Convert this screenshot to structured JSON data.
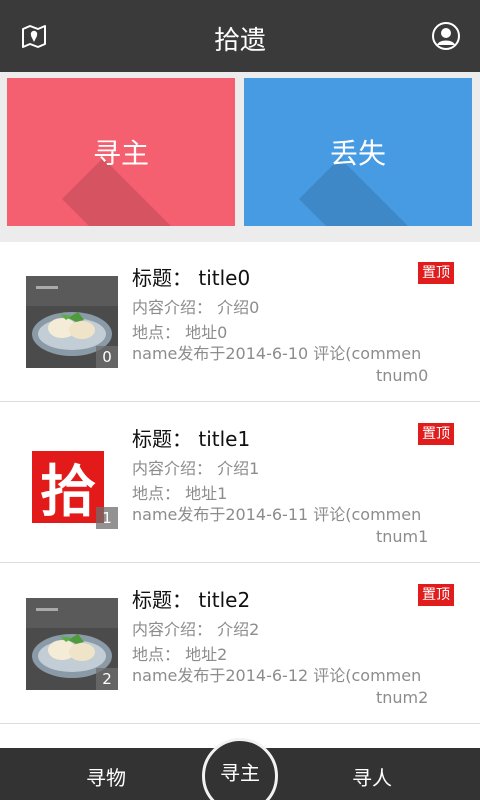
{
  "header": {
    "title": "拾遗",
    "left_icon": "map-pin-icon",
    "right_icon": "user-profile-icon"
  },
  "tiles": [
    {
      "label": "寻主",
      "color": "#f4606f"
    },
    {
      "label": "丢失",
      "color": "#479be3"
    }
  ],
  "list": {
    "items": [
      {
        "title": "标题： title0",
        "intro": "内容介绍： 介绍0",
        "location": "地点： 地址0",
        "meta_line1": "name发布于2014-6-10 评论(commen",
        "meta_line2": "tnum0",
        "pin": "置顶",
        "count": "0",
        "thumb": "dessert-photo"
      },
      {
        "title": "标题： title1",
        "intro": "内容介绍： 介绍1",
        "location": "地点： 地址1",
        "meta_line1": "name发布于2014-6-11 评论(commen",
        "meta_line2": "tnum1",
        "pin": "置顶",
        "count": "1",
        "thumb": "logo",
        "logo_char": "拾"
      },
      {
        "title": "标题： title2",
        "intro": "内容介绍： 介绍2",
        "location": "地点： 地址2",
        "meta_line1": "name发布于2014-6-12 评论(commen",
        "meta_line2": "tnum2",
        "pin": "置顶",
        "count": "2",
        "thumb": "dessert-photo"
      }
    ]
  },
  "bottom_nav": {
    "left": "寻物",
    "center": "寻主",
    "right": "寻人"
  },
  "colors": {
    "topbar": "#3a3a3a",
    "pin_red": "#e11c1c",
    "logo_red": "#e31a1a"
  }
}
